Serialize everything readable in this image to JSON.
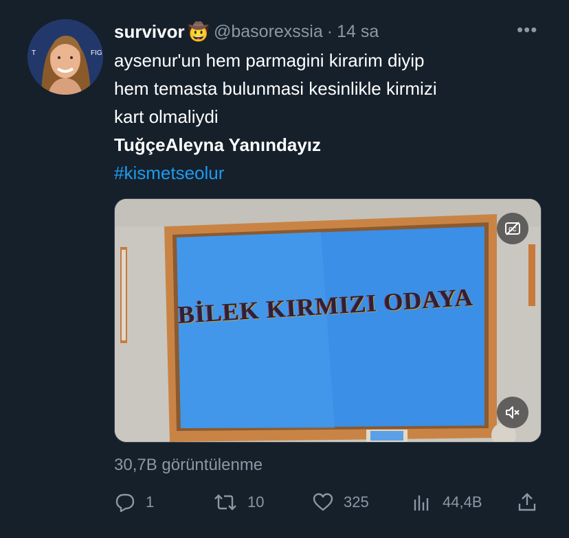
{
  "tweet": {
    "display_name": "survivor",
    "name_emoji": "🤠",
    "handle": "@basorexssia",
    "separator": "·",
    "time": "14 sa",
    "more": "•••",
    "lines": [
      "aysenur'un hem parmagini kirarim diyip",
      "hem temasta bulunmasi kesinlikle kirmizi",
      "kart olmaliydi"
    ],
    "bold_line": "TuğçeAleyna Yanındayız",
    "hashtag": "#kismetseolur",
    "media": {
      "caption": "BİLEK KIRMIZI ODAYA",
      "cc_icon": "captions-off-icon",
      "mute_icon": "volume-muted-icon"
    },
    "views_text": "30,7B görüntülenme",
    "actions": {
      "reply_count": "1",
      "retweet_count": "10",
      "like_count": "325",
      "views_count": "44,4B"
    }
  },
  "colors": {
    "background": "#15202b",
    "muted": "#8b98a5",
    "link": "#1d9bf0"
  }
}
